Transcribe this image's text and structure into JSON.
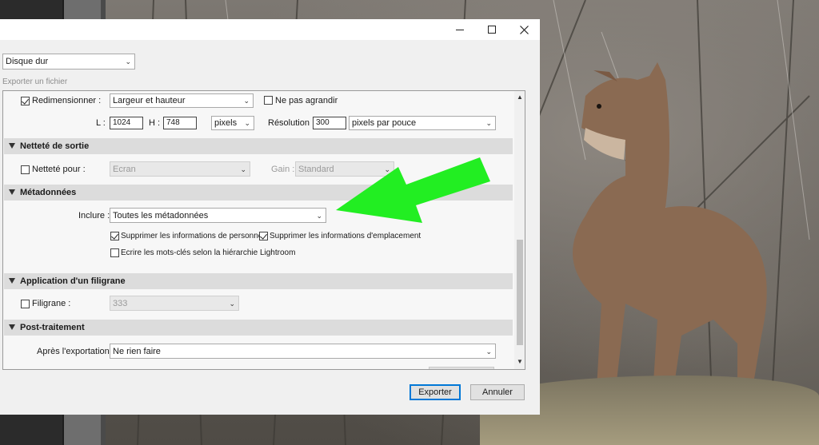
{
  "window": {
    "minimize_icon": "minimize-icon",
    "maximize_icon": "maximize-icon",
    "close_icon": "close-icon"
  },
  "destination": {
    "value": "Disque dur"
  },
  "export_label": "Exporter un fichier",
  "resize": {
    "checkbox_label": "Redimensionner :",
    "checked": true,
    "mode": "Largeur et hauteur",
    "no_enlarge_label": "Ne pas agrandir",
    "no_enlarge_checked": false,
    "width_label": "L :",
    "width_value": "1024",
    "height_label": "H :",
    "height_value": "748",
    "unit": "pixels",
    "resolution_label": "Résolution :",
    "resolution_value": "300",
    "resolution_unit": "pixels par pouce"
  },
  "sharpening": {
    "header": "Netteté de sortie",
    "checkbox_label": "Netteté pour :",
    "checked": false,
    "target": "Ecran",
    "amount_label": "Gain :",
    "amount": "Standard"
  },
  "metadata": {
    "header": "Métadonnées",
    "include_label": "Inclure :",
    "include_value": "Toutes les métadonnées",
    "remove_person_label": "Supprimer les informations de personne",
    "remove_person_checked": true,
    "remove_location_label": "Supprimer les informations d'emplacement",
    "remove_location_checked": true,
    "keywords_label": "Ecrire les mots-clés selon la hiérarchie Lightroom",
    "keywords_checked": false
  },
  "watermark": {
    "header": "Application d'un filigrane",
    "checkbox_label": "Filigrane :",
    "checked": false,
    "value": "333"
  },
  "post_processing": {
    "header": "Post-traitement",
    "after_label": "Après l'exportation :",
    "after_value": "Ne rien faire"
  },
  "buttons": {
    "export": "Exporter",
    "cancel": "Annuler"
  },
  "colors": {
    "annotation_arrow": "#22ee22",
    "primary_border": "#0078d7"
  }
}
